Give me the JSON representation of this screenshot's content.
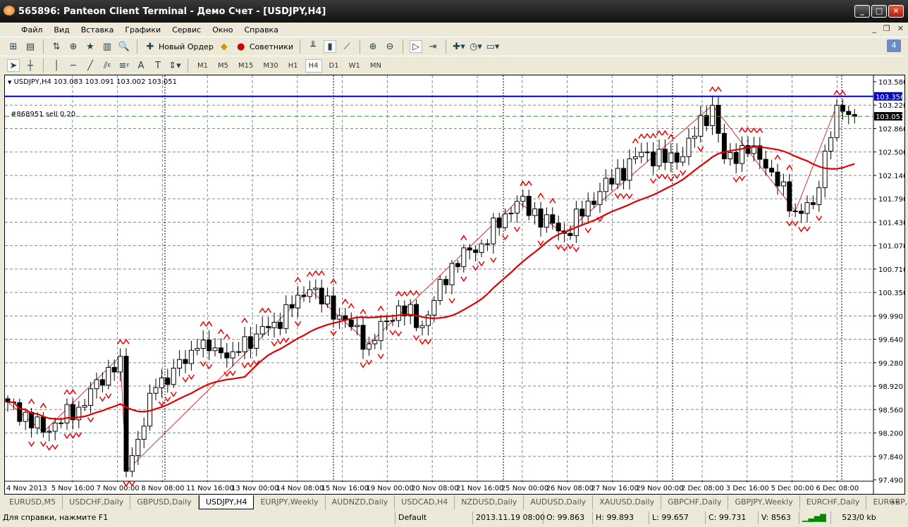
{
  "window": {
    "title": "565896: Panteon Client Terminal - Демо Счет - [USDJPY,H4]"
  },
  "menu": [
    "Файл",
    "Вид",
    "Вставка",
    "Графики",
    "Сервис",
    "Окно",
    "Справка"
  ],
  "toolbar": {
    "new_order": "Новый Ордер",
    "experts": "Советники",
    "notifications_count": "4"
  },
  "draw_tools": {
    "fibo_e": "E",
    "fibo_f": "F",
    "text": "A",
    "label": "T"
  },
  "timeframes": [
    "M1",
    "M5",
    "M15",
    "M30",
    "H1",
    "H4",
    "D1",
    "W1",
    "MN"
  ],
  "active_timeframe": "H4",
  "chart": {
    "header": "USDJPY,H4  103.083 103.091 103.002 103.051",
    "order_label": "#868951 sell 0.20",
    "line_blue_label": "103.356",
    "bid_label": "103.051",
    "colors": {
      "bull": "#ffffff",
      "bear": "#000000",
      "ma": "#e00000",
      "zigzag": "#e00000",
      "blue_line": "#0000c8",
      "order_line": "#00b000"
    }
  },
  "chart_data": {
    "type": "candlestick",
    "symbol": "USDJPY",
    "timeframe": "H4",
    "ylim": [
      97.49,
      103.58
    ],
    "y_ticks": [
      "103.580",
      "103.220",
      "102.860",
      "102.500",
      "102.140",
      "101.790",
      "101.430",
      "101.070",
      "100.710",
      "100.350",
      "99.990",
      "99.640",
      "99.280",
      "98.920",
      "98.560",
      "98.200",
      "97.840",
      "97.490"
    ],
    "x_ticks": [
      "4 Nov 2013",
      "5 Nov 16:00",
      "7 Nov 00:00",
      "8 Nov 08:00",
      "11 Nov 16:00",
      "13 Nov 00:00",
      "14 Nov 08:00",
      "15 Nov 16:00",
      "19 Nov 00:00",
      "20 Nov 08:00",
      "21 Nov 16:00",
      "25 Nov 00:00",
      "26 Nov 08:00",
      "27 Nov 16:00",
      "29 Nov 00:00",
      "2 Dec 08:00",
      "3 Dec 16:00",
      "5 Dec 00:00",
      "6 Dec 08:00"
    ],
    "bars": 144,
    "price_path": [
      [
        0,
        98.68
      ],
      [
        6,
        98.22
      ],
      [
        12,
        98.6
      ],
      [
        19,
        99.38
      ],
      [
        20,
        97.62
      ],
      [
        25,
        98.9
      ],
      [
        32,
        99.5
      ],
      [
        38,
        99.45
      ],
      [
        45,
        99.9
      ],
      [
        51,
        100.4
      ],
      [
        56,
        100.0
      ],
      [
        61,
        99.57
      ],
      [
        66,
        100.15
      ],
      [
        70,
        99.85
      ],
      [
        75,
        100.8
      ],
      [
        80,
        101.1
      ],
      [
        86,
        101.75
      ],
      [
        94,
        101.26
      ],
      [
        100,
        101.9
      ],
      [
        107,
        102.5
      ],
      [
        113,
        102.35
      ],
      [
        119,
        103.22
      ],
      [
        121,
        102.4
      ],
      [
        126,
        102.6
      ],
      [
        133,
        101.6
      ],
      [
        136,
        101.7
      ],
      [
        140,
        103.22
      ],
      [
        143,
        103.05
      ]
    ],
    "horizontal_levels": [
      103.356,
      103.051
    ],
    "last_ohlc": {
      "open": 103.083,
      "high": 103.091,
      "low": 103.002,
      "close": 103.051
    }
  },
  "tabs": [
    "EURUSD,M5",
    "USDCHF,Daily",
    "GBPUSD,Daily",
    "USDJPY,H4",
    "EURJPY,Weekly",
    "AUDNZD,Daily",
    "USDCAD,H4",
    "NZDUSD,Daily",
    "AUDUSD,Daily",
    "XAUUSD,Daily",
    "GBPCHF,Daily",
    "GBPJPY,Weekly",
    "EURCHF,Daily",
    "EURGBP,Daily"
  ],
  "active_tab": "USDJPY,H4",
  "status": {
    "help": "Для справки, нажмите F1",
    "profile": "Default",
    "time": "2013.11.19 08:00",
    "open": "O: 99.863",
    "high": "H: 99.893",
    "low": "L: 99.657",
    "close": "C: 99.731",
    "volume": "V: 8563",
    "traffic": "523/0 kb"
  }
}
